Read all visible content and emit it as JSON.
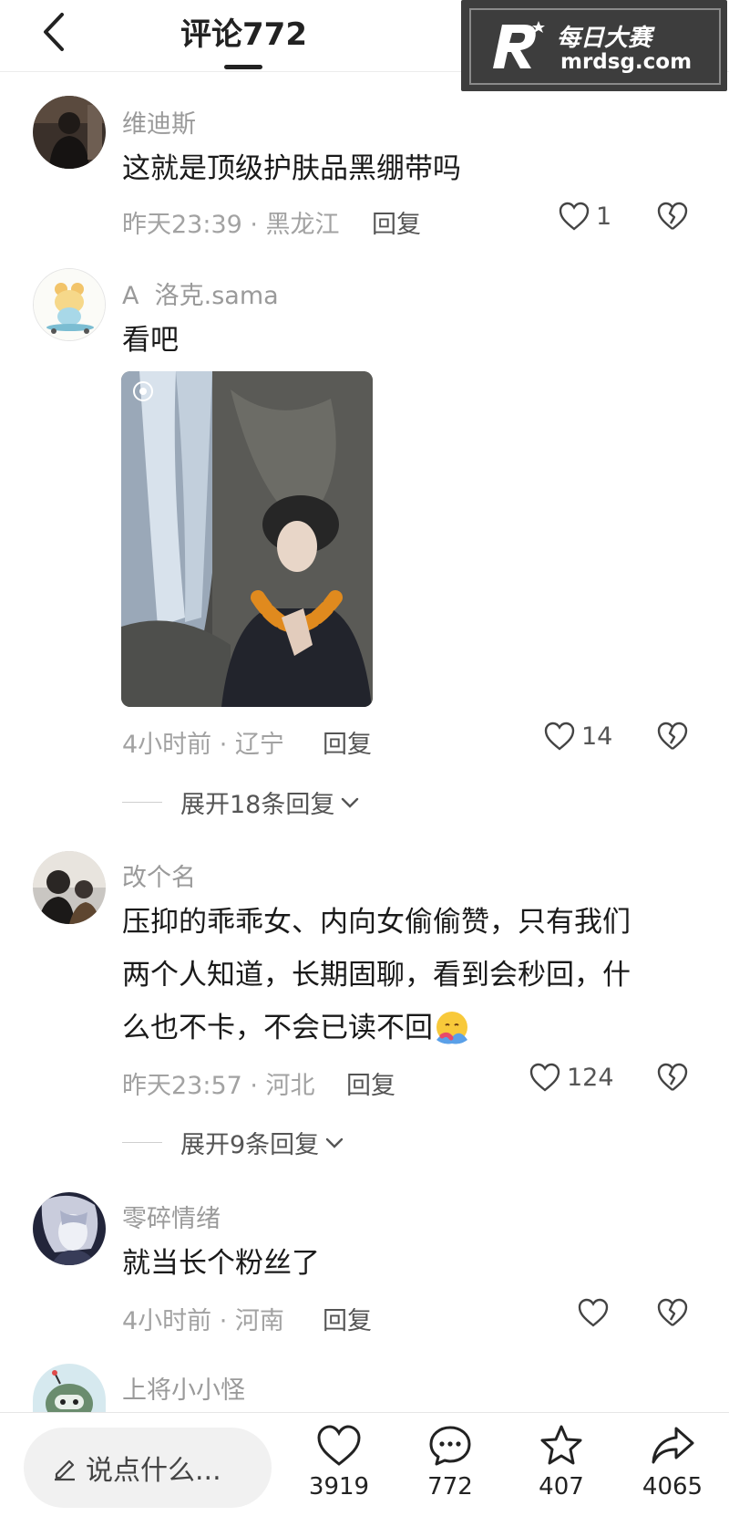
{
  "header": {
    "title": "评论772",
    "back_icon": "chevron-left-icon"
  },
  "watermark": {
    "name": "每日大赛",
    "url": "mrdsg.com",
    "logo_letter": "R"
  },
  "comments": [
    {
      "user": "维迪斯",
      "text": "这就是顶级护肤品黑绷带吗",
      "meta": "昨天23:39 · 黑龙江",
      "reply": "回复",
      "likes": "1"
    },
    {
      "user": "A  洛克.sama",
      "text": "看吧",
      "meta": "4小时前 · 辽宁",
      "reply": "回复",
      "likes": "14",
      "expand": "展开18条回复"
    },
    {
      "user": "改个名",
      "text_lines": [
        "压抑的乖乖女、内向女偷偷赞，只有我们",
        "两个人知道，长期固聊，看到会秒回，什",
        "么也不卡，不会已读不回"
      ],
      "meta": "昨天23:57 · 河北",
      "reply": "回复",
      "likes": "124",
      "expand": "展开9条回复"
    },
    {
      "user": "零碎情绪",
      "text": "就当长个粉丝了",
      "meta": "4小时前 · 河南",
      "reply": "回复",
      "likes": ""
    },
    {
      "user": "上将小小怪"
    }
  ],
  "bottom": {
    "input_placeholder": "说点什么...",
    "likes": "3919",
    "comments": "772",
    "favorites": "407",
    "shares": "4065"
  },
  "colors": {
    "text": "#1a1a1a",
    "meta": "#a2a2a2",
    "name": "#9a9a9a",
    "accent": "#222222"
  }
}
